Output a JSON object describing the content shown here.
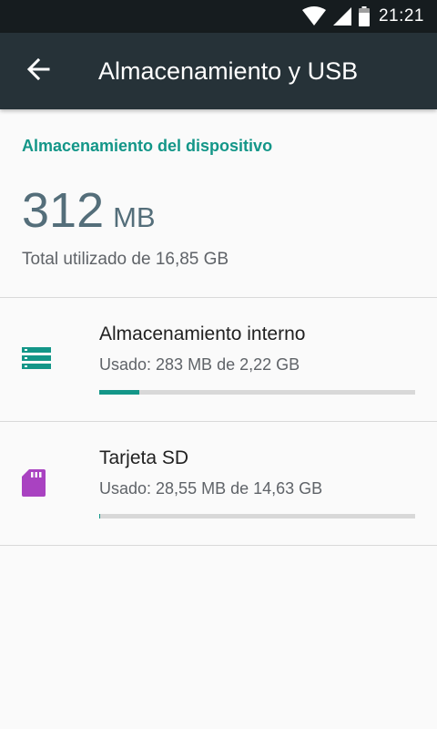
{
  "status_bar": {
    "time": "21:21",
    "icons": [
      "wifi-icon",
      "cell-signal-icon",
      "battery-icon"
    ]
  },
  "app_bar": {
    "back_icon": "arrow-back-icon",
    "title": "Almacenamiento y USB"
  },
  "colors": {
    "accent": "#139688",
    "app_bar": "#263238",
    "status_bar": "#161c1f",
    "sd_icon": "#a942c1"
  },
  "device_storage": {
    "header": "Almacenamiento del dispositivo",
    "used_value": "312",
    "used_unit": "MB",
    "total_text": "Total utilizado de 16,85 GB"
  },
  "storage_items": [
    {
      "icon": "internal-storage-icon",
      "title": "Almacenamiento interno",
      "subtitle": "Usado: 283 MB de 2,22 GB",
      "used_fraction": 0.127
    },
    {
      "icon": "sd-card-icon",
      "title": "Tarjeta SD",
      "subtitle": "Usado: 28,55 MB de 14,63 GB",
      "used_fraction": 0.002
    }
  ]
}
